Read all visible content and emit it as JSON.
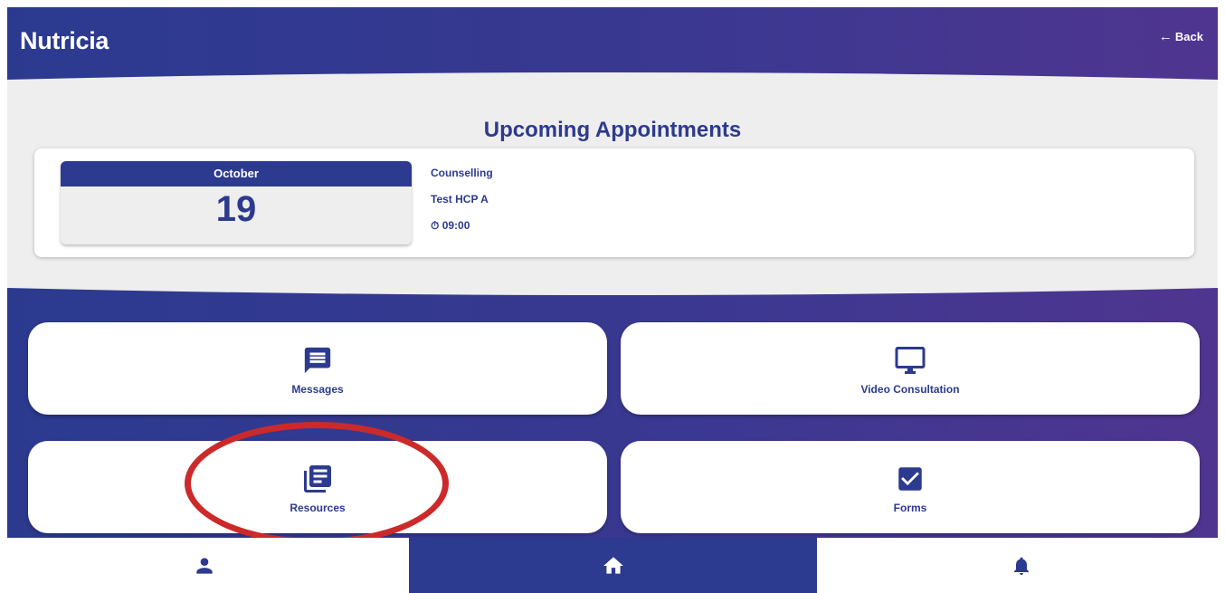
{
  "header": {
    "brand": "Nutricia",
    "back_label": "Back"
  },
  "appointments": {
    "title": "Upcoming Appointments",
    "items": [
      {
        "month": "October",
        "day": "19",
        "type": "Counselling",
        "provider": "Test HCP A",
        "time_icon": "stopwatch-icon",
        "time": "⏱ 09:00"
      }
    ]
  },
  "tiles": [
    {
      "label": "Messages",
      "icon": "chat-message-icon"
    },
    {
      "label": "Video Consultation",
      "icon": "monitor-icon"
    },
    {
      "label": "Resources",
      "icon": "library-books-icon"
    },
    {
      "label": "Forms",
      "icon": "checkbox-icon"
    }
  ],
  "bottom_nav": [
    {
      "icon": "person-icon",
      "active": false
    },
    {
      "icon": "home-icon",
      "active": true
    },
    {
      "icon": "bell-icon",
      "active": false
    }
  ],
  "colors": {
    "primary": "#2c3a8f",
    "gradient_end": "#4f3590",
    "annotation": "#cc2a2a",
    "panel": "#eeeeee"
  }
}
